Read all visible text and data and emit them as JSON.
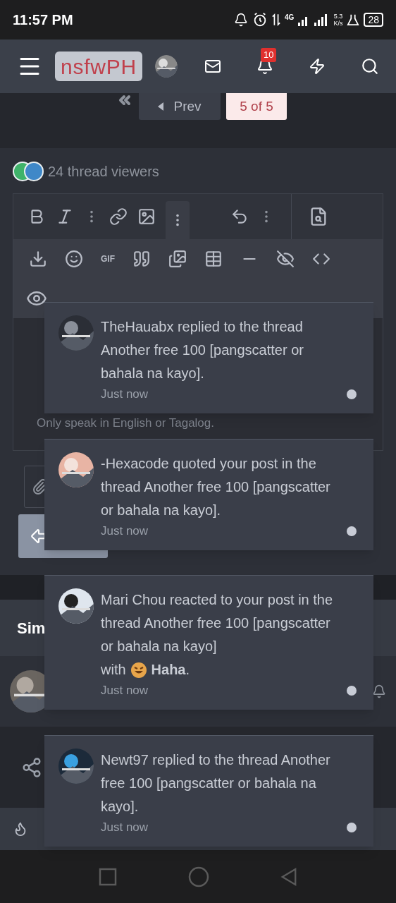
{
  "status_bar": {
    "time": "11:57 PM",
    "network": "4G",
    "speed": "5.3",
    "speed_unit": "K/s",
    "battery": "28"
  },
  "header": {
    "logo": "nsfwPH",
    "alerts_badge": "10"
  },
  "pagination": {
    "prev": "Prev",
    "current": "5 of 5"
  },
  "viewers": {
    "text": "24 thread viewers"
  },
  "editor": {
    "gif_button": "GIF",
    "rule": "Only speak in English or Tagalog."
  },
  "similar_threads": {
    "heading": "Sim"
  },
  "notifications": [
    {
      "message": "TheHauabx replied to the thread Another free 100 [pangscatter or bahala na kayo].",
      "time": "Just now",
      "unread": true
    },
    {
      "message": "-Hexacode quoted your post in the thread Another free 100 [pangscatter or bahala na kayo].",
      "time": "Just now",
      "unread": true
    },
    {
      "message": "Mari Chou reacted to your post in the thread Another free 100 [pangscatter or bahala na kayo]",
      "reaction_prefix": "with",
      "reaction": "**Haha**.",
      "time": "Just now",
      "unread": true
    },
    {
      "message": "Newt97 replied to the thread Another free 100 [pangscatter or bahala na kayo].",
      "time": "Just now",
      "unread": true
    }
  ]
}
